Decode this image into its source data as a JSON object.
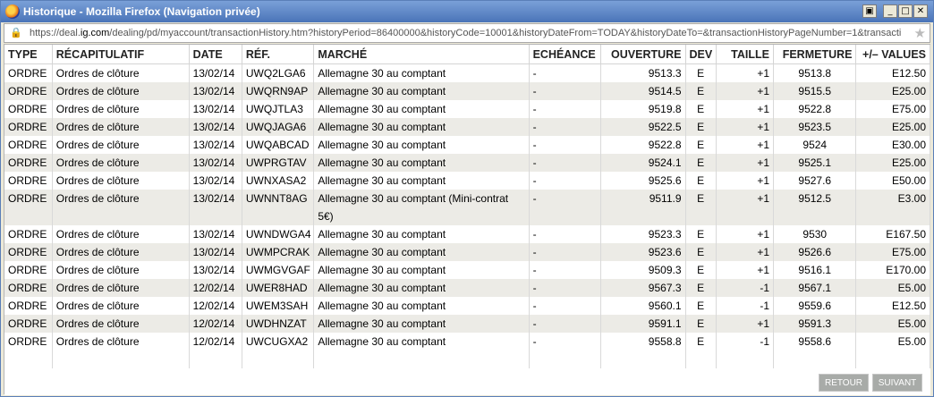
{
  "window": {
    "title": "Historique - Mozilla Firefox (Navigation privée)",
    "url_prefix": "https://deal.",
    "url_host": "ig.com",
    "url_rest": "/dealing/pd/myaccount/transactionHistory.htm?historyPeriod=86400000&historyCode=10001&historyDateFrom=TODAY&historyDateTo=&transactionHistoryPageNumber=1&transacti"
  },
  "table": {
    "headers": {
      "type": "TYPE",
      "recap": "RÉCAPITULATIF",
      "date": "DATE",
      "ref": "RÉF.",
      "marche": "MARCHÉ",
      "echeance": "ECHÉANCE",
      "ouverture": "OUVERTURE",
      "dev": "DEV",
      "taille": "TAILLE",
      "fermeture": "FERMETURE",
      "values": "+/– VALUES"
    },
    "rows": [
      {
        "type": "ORDRE",
        "recap": "Ordres de clôture",
        "date": "13/02/14",
        "ref": "UWQ2LGA6",
        "marche": "Allemagne 30 au comptant",
        "echeance": "-",
        "ouverture": "9513.3",
        "dev": "E",
        "taille": "+1",
        "fermeture": "9513.8",
        "values": "E12.50"
      },
      {
        "type": "ORDRE",
        "recap": "Ordres de clôture",
        "date": "13/02/14",
        "ref": "UWQRN9AP",
        "marche": "Allemagne 30 au comptant",
        "echeance": "-",
        "ouverture": "9514.5",
        "dev": "E",
        "taille": "+1",
        "fermeture": "9515.5",
        "values": "E25.00"
      },
      {
        "type": "ORDRE",
        "recap": "Ordres de clôture",
        "date": "13/02/14",
        "ref": "UWQJTLA3",
        "marche": "Allemagne 30 au comptant",
        "echeance": "-",
        "ouverture": "9519.8",
        "dev": "E",
        "taille": "+1",
        "fermeture": "9522.8",
        "values": "E75.00"
      },
      {
        "type": "ORDRE",
        "recap": "Ordres de clôture",
        "date": "13/02/14",
        "ref": "UWQJAGA6",
        "marche": "Allemagne 30 au comptant",
        "echeance": "-",
        "ouverture": "9522.5",
        "dev": "E",
        "taille": "+1",
        "fermeture": "9523.5",
        "values": "E25.00"
      },
      {
        "type": "ORDRE",
        "recap": "Ordres de clôture",
        "date": "13/02/14",
        "ref": "UWQABCAD",
        "marche": "Allemagne 30 au comptant",
        "echeance": "-",
        "ouverture": "9522.8",
        "dev": "E",
        "taille": "+1",
        "fermeture": "9524",
        "values": "E30.00"
      },
      {
        "type": "ORDRE",
        "recap": "Ordres de clôture",
        "date": "13/02/14",
        "ref": "UWPRGTAV",
        "marche": "Allemagne 30 au comptant",
        "echeance": "-",
        "ouverture": "9524.1",
        "dev": "E",
        "taille": "+1",
        "fermeture": "9525.1",
        "values": "E25.00"
      },
      {
        "type": "ORDRE",
        "recap": "Ordres de clôture",
        "date": "13/02/14",
        "ref": "UWNXASA2",
        "marche": "Allemagne 30 au comptant",
        "echeance": "-",
        "ouverture": "9525.6",
        "dev": "E",
        "taille": "+1",
        "fermeture": "9527.6",
        "values": "E50.00"
      },
      {
        "type": "ORDRE",
        "recap": "Ordres de clôture",
        "date": "13/02/14",
        "ref": "UWNNT8AG",
        "marche": "Allemagne 30 au comptant (Mini-contrat 5€)",
        "echeance": "-",
        "ouverture": "9511.9",
        "dev": "E",
        "taille": "+1",
        "fermeture": "9512.5",
        "values": "E3.00"
      },
      {
        "type": "ORDRE",
        "recap": "Ordres de clôture",
        "date": "13/02/14",
        "ref": "UWNDWGA4",
        "marche": "Allemagne 30 au comptant",
        "echeance": "-",
        "ouverture": "9523.3",
        "dev": "E",
        "taille": "+1",
        "fermeture": "9530",
        "values": "E167.50"
      },
      {
        "type": "ORDRE",
        "recap": "Ordres de clôture",
        "date": "13/02/14",
        "ref": "UWMPCRAK",
        "marche": "Allemagne 30 au comptant",
        "echeance": "-",
        "ouverture": "9523.6",
        "dev": "E",
        "taille": "+1",
        "fermeture": "9526.6",
        "values": "E75.00"
      },
      {
        "type": "ORDRE",
        "recap": "Ordres de clôture",
        "date": "13/02/14",
        "ref": "UWMGVGAF",
        "marche": "Allemagne 30 au comptant",
        "echeance": "-",
        "ouverture": "9509.3",
        "dev": "E",
        "taille": "+1",
        "fermeture": "9516.1",
        "values": "E170.00"
      },
      {
        "type": "ORDRE",
        "recap": "Ordres de clôture",
        "date": "12/02/14",
        "ref": "UWER8HAD",
        "marche": "Allemagne 30 au comptant",
        "echeance": "-",
        "ouverture": "9567.3",
        "dev": "E",
        "taille": "-1",
        "fermeture": "9567.1",
        "values": "E5.00"
      },
      {
        "type": "ORDRE",
        "recap": "Ordres de clôture",
        "date": "12/02/14",
        "ref": "UWEM3SAH",
        "marche": "Allemagne 30 au comptant",
        "echeance": "-",
        "ouverture": "9560.1",
        "dev": "E",
        "taille": "-1",
        "fermeture": "9559.6",
        "values": "E12.50"
      },
      {
        "type": "ORDRE",
        "recap": "Ordres de clôture",
        "date": "12/02/14",
        "ref": "UWDHNZAT",
        "marche": "Allemagne 30 au comptant",
        "echeance": "-",
        "ouverture": "9591.1",
        "dev": "E",
        "taille": "+1",
        "fermeture": "9591.3",
        "values": "E5.00"
      },
      {
        "type": "ORDRE",
        "recap": "Ordres de clôture",
        "date": "12/02/14",
        "ref": "UWCUGXA2",
        "marche": "Allemagne 30 au comptant",
        "echeance": "-",
        "ouverture": "9558.8",
        "dev": "E",
        "taille": "-1",
        "fermeture": "9558.6",
        "values": "E5.00"
      }
    ]
  },
  "footer": {
    "retour_label": "RETOUR",
    "suivant_label": "SUIVANT"
  }
}
